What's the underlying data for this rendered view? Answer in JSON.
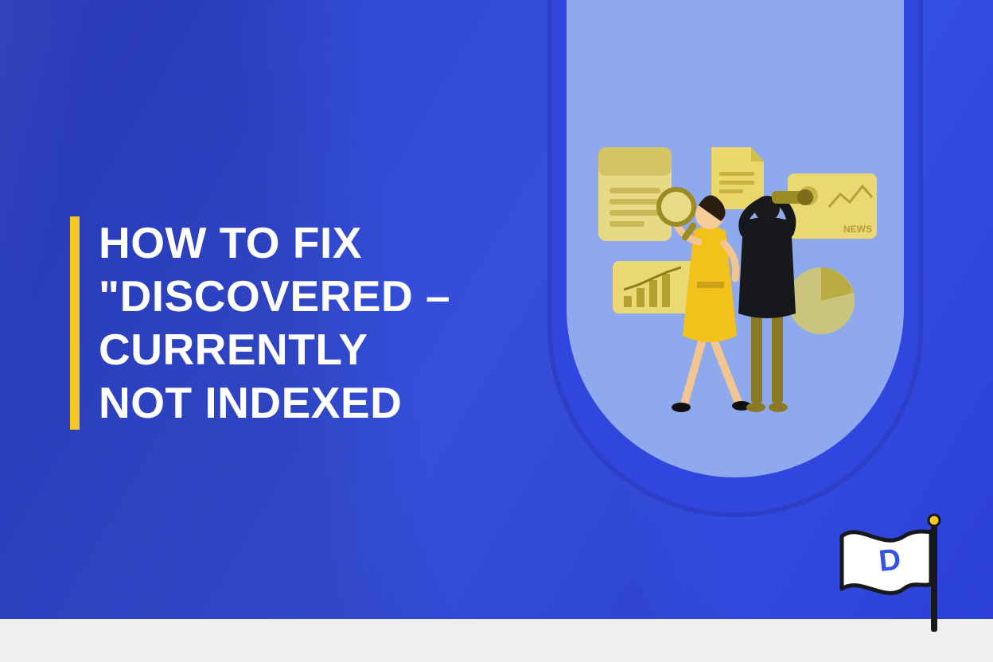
{
  "title_lines": "HOW TO FIX\n\"DISCOVERED –\nCURRENTLY\nNOT INDEXED",
  "colors": {
    "background_blue": "#3752e6",
    "accent_yellow": "#f6c922",
    "capsule_light_blue": "#8ea9ee",
    "capsule_border": "#2d3fc6",
    "page_grey": "#efefef",
    "text_white": "#ffffff",
    "illus_olive": "#8a7a24",
    "flag_letter": "D"
  },
  "logo": {
    "flag_letter": "D"
  },
  "illustration": {
    "news_label": "NEWS",
    "elements": [
      "document-sheet",
      "page-file",
      "news-panel",
      "bar-chart-panel",
      "pie-chart",
      "magnifying-glass",
      "binoculars",
      "woman-yellow-dress",
      "man-olive-outfit"
    ]
  }
}
